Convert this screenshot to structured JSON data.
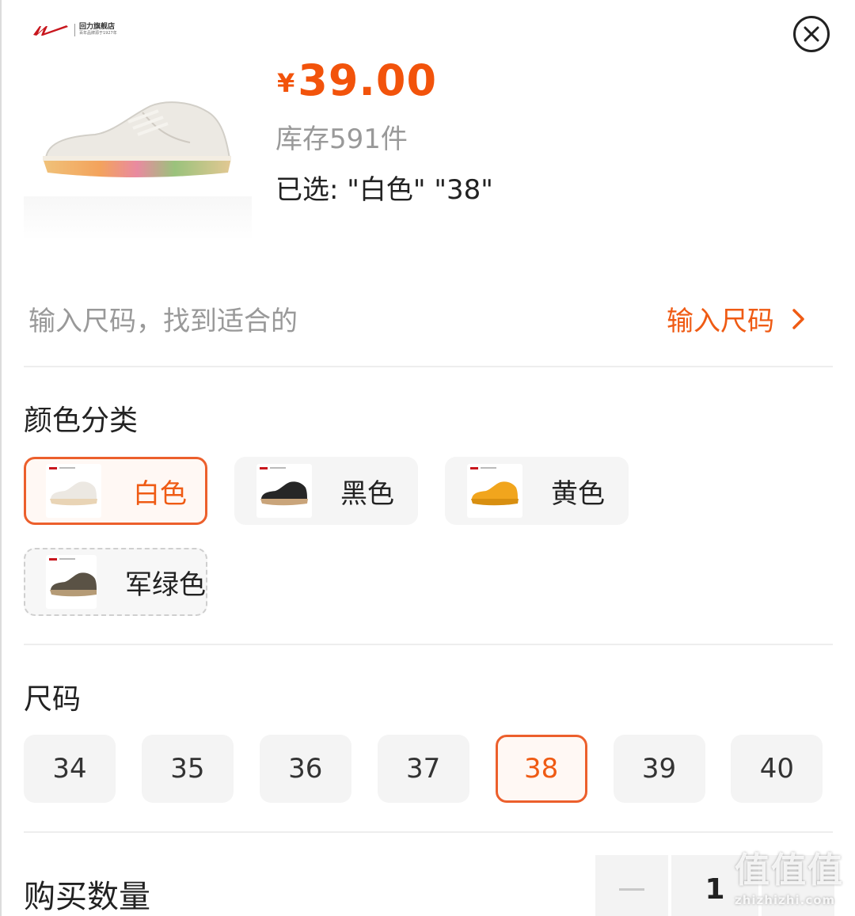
{
  "product": {
    "brand_name": "回力旗舰店",
    "brand_sub": "百年品牌源于1927年",
    "currency": "¥",
    "price": "39.00",
    "stock": "库存591件",
    "selected": "已选: \"白色\" \"38\""
  },
  "size_finder": {
    "hint": "输入尺码，找到适合的",
    "link": "输入尺码"
  },
  "colors": {
    "title": "颜色分类",
    "options": [
      {
        "label": "白色",
        "state": "selected",
        "shoe_color": "#ece8e2",
        "sole_color": "#e9d4b5"
      },
      {
        "label": "黑色",
        "state": "available",
        "shoe_color": "#262626",
        "sole_color": "#c9a47a"
      },
      {
        "label": "黄色",
        "state": "available",
        "shoe_color": "#f1a51d",
        "sole_color": "#d88f10"
      },
      {
        "label": "军绿色",
        "state": "unavailable",
        "shoe_color": "#5a5245",
        "sole_color": "#b59b76"
      }
    ]
  },
  "sizes": {
    "title": "尺码",
    "options": [
      "34",
      "35",
      "36",
      "37",
      "38",
      "39",
      "40"
    ],
    "selected": "38"
  },
  "quantity": {
    "label": "购买数量",
    "value": "1"
  },
  "watermark": {
    "main": "值值值",
    "site": "zhizhizhi.com"
  },
  "colors_theme": {
    "accent": "#ef5b14",
    "chip_bg": "#f5f5f5"
  }
}
